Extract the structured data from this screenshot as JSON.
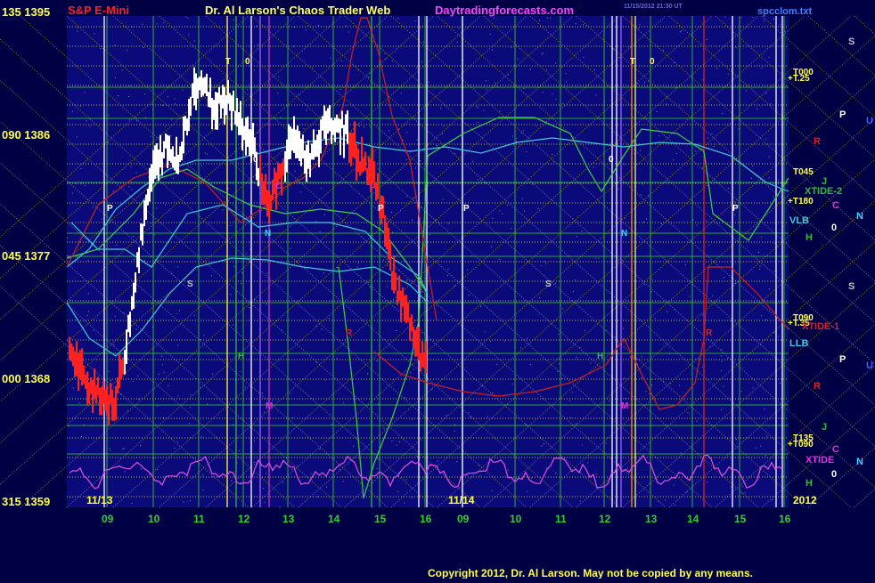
{
  "header": {
    "symbol": "S&P E-Mini",
    "title": "Dr. Al Larson's Chaos Trader Web",
    "site": "Daytradingforecasts.com",
    "file": "spcclom.txt",
    "timestamp_line1": "11/15/2012 21:30 UT"
  },
  "copyright": "Copyright 2012, Dr. Al Larson. May not be copied by any means.",
  "colors": {
    "background": "#000044",
    "plot_background": "#0a0a7a",
    "grid_yellow": "#e8e020",
    "grid_green": "#30c030",
    "price_white": "#ffffff",
    "price_red": "#ff2020",
    "red_curve": "#cc2020",
    "green_curve": "#40d040",
    "cyan_curve": "#40c8d8",
    "magenta_curve": "#e050e0"
  },
  "chart_data": {
    "type": "line",
    "title": "S&P E-Mini",
    "y_axis_labels": [
      {
        "angle": "135",
        "price": "1395"
      },
      {
        "angle": "090",
        "price": "1386"
      },
      {
        "angle": "045",
        "price": "1377"
      },
      {
        "angle": "000",
        "price": "1368"
      },
      {
        "angle": "315",
        "price": "1359"
      }
    ],
    "ylim": [
      1359,
      1395
    ],
    "x_hour_labels": [
      "09",
      "10",
      "11",
      "12",
      "13",
      "14",
      "15",
      "16",
      "09",
      "10",
      "11",
      "12",
      "13",
      "14",
      "15",
      "16"
    ],
    "date_labels": [
      "11/13",
      "11/14"
    ],
    "year_label": "2012",
    "right_labels": [
      {
        "text": "S",
        "color": "#c0c0c0"
      },
      {
        "text": "P",
        "color": "#ffffff"
      },
      {
        "text": "U",
        "color": "#4060ff"
      },
      {
        "text": "R",
        "color": "#e02020"
      },
      {
        "text": "J",
        "color": "#30c030"
      },
      {
        "text": "XTIDE-2",
        "color": "#30c030"
      },
      {
        "text": "C",
        "color": "#e030e0"
      },
      {
        "text": "VLB",
        "color": "#40c8e8"
      },
      {
        "text": "N",
        "color": "#40d0ff"
      },
      {
        "text": "0",
        "color": "#ffffff"
      },
      {
        "text": "H",
        "color": "#30c030"
      },
      {
        "text": "T000",
        "color": "#ffff40"
      },
      {
        "text": "+T.25",
        "color": "#ffff40"
      },
      {
        "text": "T045",
        "color": "#ffff40"
      },
      {
        "text": "+T180",
        "color": "#ffff40"
      },
      {
        "text": "S",
        "color": "#c0c0c0"
      },
      {
        "text": "T090",
        "color": "#ffff40"
      },
      {
        "text": "+T.35",
        "color": "#ffff40"
      },
      {
        "text": "XTIDE-1",
        "color": "#e02020"
      },
      {
        "text": "LLB",
        "color": "#40c8e8"
      },
      {
        "text": "P",
        "color": "#ffffff"
      },
      {
        "text": "U",
        "color": "#4060ff"
      },
      {
        "text": "R",
        "color": "#e02020"
      },
      {
        "text": "J",
        "color": "#30c030"
      },
      {
        "text": "T135",
        "color": "#ffff40"
      },
      {
        "text": "+T090",
        "color": "#ffff40"
      },
      {
        "text": "C",
        "color": "#e030e0"
      },
      {
        "text": "XTIDE",
        "color": "#e030e0"
      },
      {
        "text": "N",
        "color": "#40d0ff"
      },
      {
        "text": "0",
        "color": "#ffffff"
      },
      {
        "text": "H",
        "color": "#30c030"
      }
    ],
    "in_plot_labels": [
      {
        "text": "T",
        "color": "#ffff40"
      },
      {
        "text": "0",
        "color": "#ffff40"
      },
      {
        "text": "T",
        "color": "#ffff40"
      },
      {
        "text": "0",
        "color": "#ffff40"
      },
      {
        "text": "0",
        "color": "#ffffff"
      },
      {
        "text": "0",
        "color": "#ffffff"
      },
      {
        "text": "P",
        "color": "#ffffff"
      },
      {
        "text": "P",
        "color": "#ffffff"
      },
      {
        "text": "P",
        "color": "#ffffff"
      },
      {
        "text": "P",
        "color": "#ffffff"
      },
      {
        "text": "S",
        "color": "#c0c0c0"
      },
      {
        "text": "S",
        "color": "#c0c0c0"
      },
      {
        "text": "N",
        "color": "#40d0ff"
      },
      {
        "text": "N",
        "color": "#40d0ff"
      },
      {
        "text": "H",
        "color": "#30c030"
      },
      {
        "text": "H",
        "color": "#30c030"
      },
      {
        "text": "M",
        "color": "#e030e0"
      },
      {
        "text": "M",
        "color": "#e030e0"
      },
      {
        "text": "C",
        "color": "#e030e0"
      },
      {
        "text": "R",
        "color": "#e02020"
      },
      {
        "text": "R",
        "color": "#e02020"
      }
    ]
  }
}
